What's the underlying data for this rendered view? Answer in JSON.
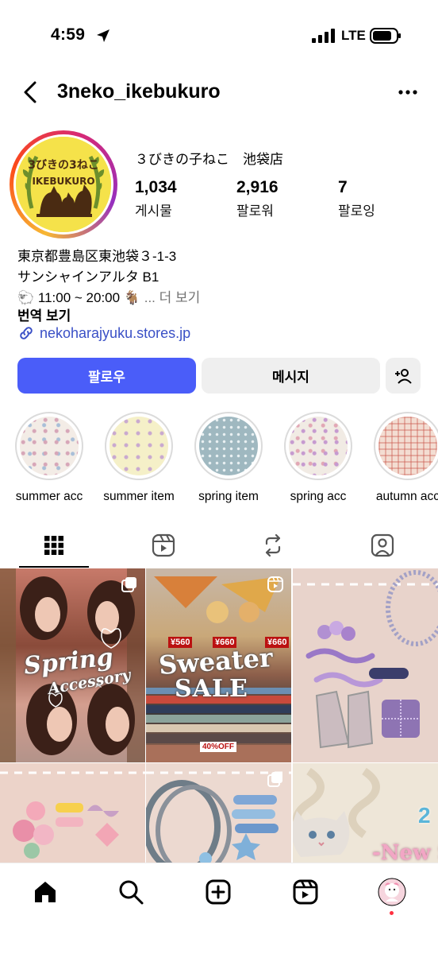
{
  "status_bar": {
    "time": "4:59",
    "network": "LTE"
  },
  "header": {
    "username": "3neko_ikebukuro"
  },
  "profile": {
    "display_name": "３びきの子ねこ　池袋店",
    "avatar_text": {
      "top": "3びきの3ねこ",
      "bottom": "IKEBUKURO"
    },
    "stats": [
      {
        "value": "1,034",
        "label": "게시물"
      },
      {
        "value": "2,916",
        "label": "팔로워"
      },
      {
        "value": "7",
        "label": "팔로잉"
      }
    ],
    "bio": {
      "line1": "東京都豊島区東池袋３-1-3",
      "line2": "サンシャインアルタ B1",
      "line3_prefix": "🐑 11:00 ~ 20:00 🐐",
      "line3_more": "... 더 보기"
    },
    "translate": "번역 보기",
    "link": "nekoharajyuku.stores.jp"
  },
  "actions": {
    "follow": "팔로우",
    "message": "메시지"
  },
  "highlights": [
    {
      "label": "summer acc",
      "color": "#f3ece6"
    },
    {
      "label": "summer item",
      "color": "#f5f0c8"
    },
    {
      "label": "spring item",
      "color": "#9fb8c0"
    },
    {
      "label": "spring acc",
      "color": "#f1ebe4"
    },
    {
      "label": "autumn acc",
      "color": "#ebc7b8"
    }
  ],
  "posts": [
    {
      "texts": [
        "Spring",
        "Accessory"
      ]
    },
    {
      "texts": [
        "¥560",
        "¥660",
        "¥660",
        "Sweater",
        "SALE",
        "40%OFF"
      ]
    },
    {
      "texts": []
    },
    {
      "texts": []
    },
    {
      "texts": []
    },
    {
      "texts": [
        "2",
        "-New S"
      ]
    }
  ],
  "colors": {
    "accent": "#4a5df9",
    "link": "#3a50c6",
    "muted": "#737373",
    "notification": "#ff3040"
  }
}
